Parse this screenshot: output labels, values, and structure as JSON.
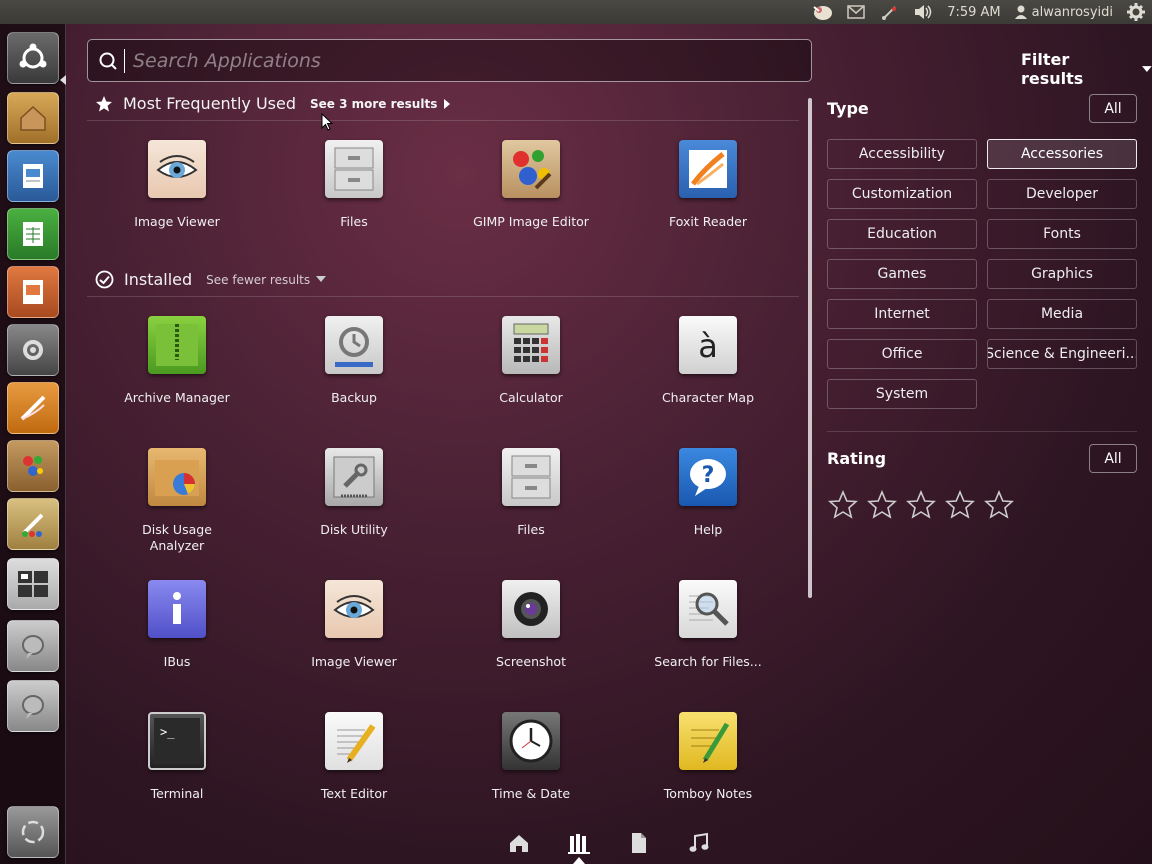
{
  "top_panel": {
    "time": "7:59 AM",
    "username": "alwanrosyidi",
    "icons": [
      "pidgin-icon",
      "mail-icon",
      "network-icon",
      "volume-icon",
      "user-icon",
      "gear-icon"
    ]
  },
  "search": {
    "placeholder": "Search Applications",
    "value": ""
  },
  "sections": {
    "frequent": {
      "title": "Most Frequently Used",
      "link": "See 3 more results"
    },
    "installed": {
      "title": "Installed",
      "link": "See fewer results"
    }
  },
  "frequent_apps": [
    {
      "label": "Image Viewer",
      "icon": "image-viewer-icon"
    },
    {
      "label": "Files",
      "icon": "files-icon"
    },
    {
      "label": "GIMP Image Editor",
      "icon": "gimp-icon"
    },
    {
      "label": "Foxit Reader",
      "icon": "foxit-icon"
    }
  ],
  "installed_apps": [
    {
      "label": "Archive Manager",
      "icon": "archive-icon"
    },
    {
      "label": "Backup",
      "icon": "backup-icon"
    },
    {
      "label": "Calculator",
      "icon": "calculator-icon"
    },
    {
      "label": "Character Map",
      "icon": "charmap-icon"
    },
    {
      "label": "Disk Usage Analyzer",
      "icon": "disk-usage-icon"
    },
    {
      "label": "Disk Utility",
      "icon": "disk-utility-icon"
    },
    {
      "label": "Files",
      "icon": "files-icon"
    },
    {
      "label": "Help",
      "icon": "help-icon"
    },
    {
      "label": "IBus",
      "icon": "ibus-icon"
    },
    {
      "label": "Image Viewer",
      "icon": "image-viewer-icon"
    },
    {
      "label": "Screenshot",
      "icon": "screenshot-icon"
    },
    {
      "label": "Search for Files...",
      "icon": "search-files-icon"
    },
    {
      "label": "Terminal",
      "icon": "terminal-icon"
    },
    {
      "label": "Text Editor",
      "icon": "text-editor-icon"
    },
    {
      "label": "Time & Date",
      "icon": "clock-icon"
    },
    {
      "label": "Tomboy Notes",
      "icon": "tomboy-icon"
    }
  ],
  "filter": {
    "title": "Filter results",
    "type_heading": "Type",
    "rating_heading": "Rating",
    "all_label": "All",
    "categories": [
      "Accessibility",
      "Accessories",
      "Customization",
      "Developer",
      "Education",
      "Fonts",
      "Games",
      "Graphics",
      "Internet",
      "Media",
      "Office",
      "Science & Engineeri...",
      "System"
    ],
    "active_category": "Accessories",
    "rating_stars": 5
  },
  "lenses": [
    "home-lens-icon",
    "applications-lens-icon",
    "files-lens-icon",
    "music-lens-icon"
  ],
  "active_lens": "applications-lens-icon"
}
